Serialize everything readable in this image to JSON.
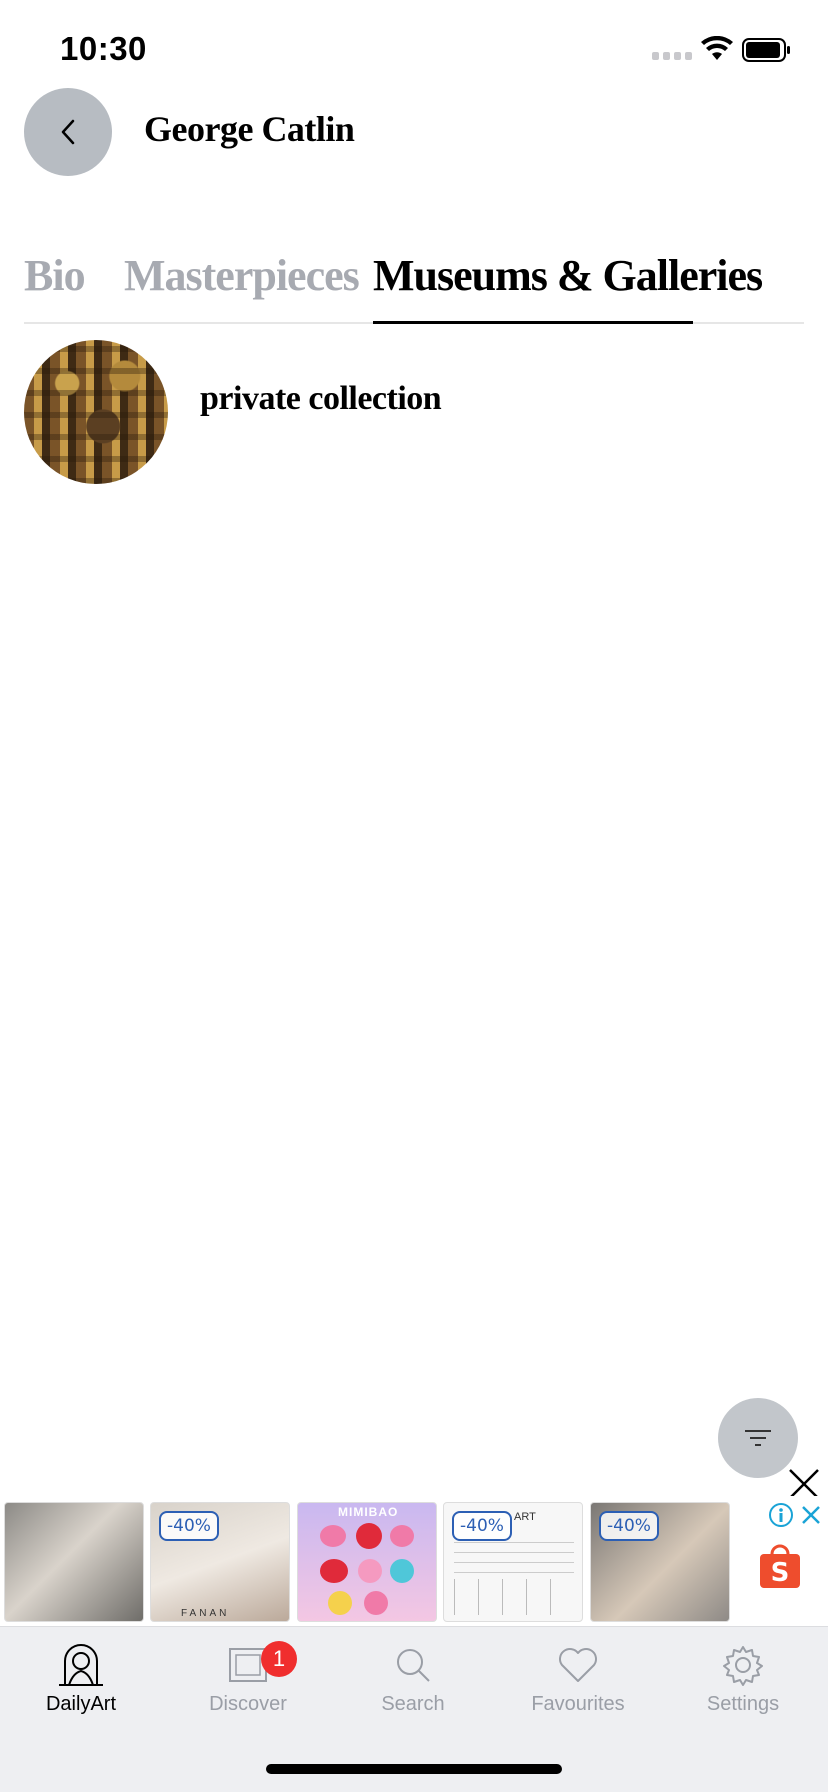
{
  "status_bar": {
    "time": "10:30"
  },
  "header": {
    "title": "George Catlin"
  },
  "tabs": [
    {
      "label": "Bio",
      "active": false
    },
    {
      "label": "Masterpieces",
      "active": false
    },
    {
      "label": "Museums & Galleries",
      "active": true
    }
  ],
  "museums": [
    {
      "name": "private collection"
    }
  ],
  "ad": {
    "tiles": [
      {
        "badge": ""
      },
      {
        "badge": "-40%",
        "caption": "FANAN"
      },
      {
        "badge": "",
        "caption": "MIMIBAO"
      },
      {
        "badge": "-40%",
        "caption": "ART"
      },
      {
        "badge": "-40%"
      }
    ],
    "shop_icon_letter": "S"
  },
  "tab_bar": {
    "items": [
      {
        "label": "DailyArt",
        "icon": "dailyart-icon",
        "active": true
      },
      {
        "label": "Discover",
        "icon": "discover-icon",
        "active": false,
        "badge": "1"
      },
      {
        "label": "Search",
        "icon": "search-icon",
        "active": false
      },
      {
        "label": "Favourites",
        "icon": "heart-icon",
        "active": false
      },
      {
        "label": "Settings",
        "icon": "gear-icon",
        "active": false
      }
    ]
  },
  "colors": {
    "accent": "#000000",
    "inactive_tab": "#a7aab1",
    "badge": "#f02e2e",
    "ad_badge": "#2c5fb4",
    "shopee": "#ee4d2d"
  }
}
